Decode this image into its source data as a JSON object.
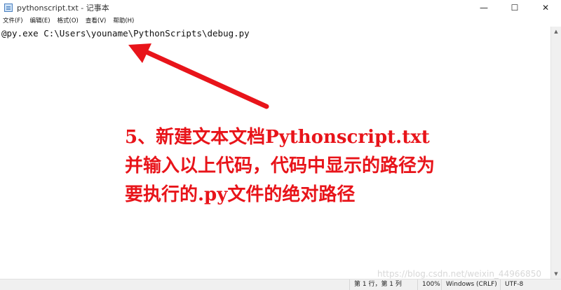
{
  "window": {
    "title": "pythonscript.txt - 记事本",
    "minimize_glyph": "—",
    "maximize_glyph": "☐",
    "close_glyph": "✕"
  },
  "menu": [
    "文件(F)",
    "编辑(E)",
    "格式(O)",
    "查看(V)",
    "帮助(H)"
  ],
  "editor": {
    "content": "@py.exe C:\\Users\\youname\\PythonScripts\\debug.py"
  },
  "annotation": {
    "lines": [
      "5、新建文本文档Pythonscript.txt",
      "并输入以上代码，代码中显示的路径为",
      "要执行的.py文件的绝对路径"
    ],
    "color": "#e8141a"
  },
  "watermark": "https://blog.csdn.net/weixin_44966850",
  "statusbar": {
    "position": "第 1 行，第 1 列",
    "zoom": "100%",
    "line_ending": "Windows (CRLF)",
    "encoding": "UTF-8"
  }
}
